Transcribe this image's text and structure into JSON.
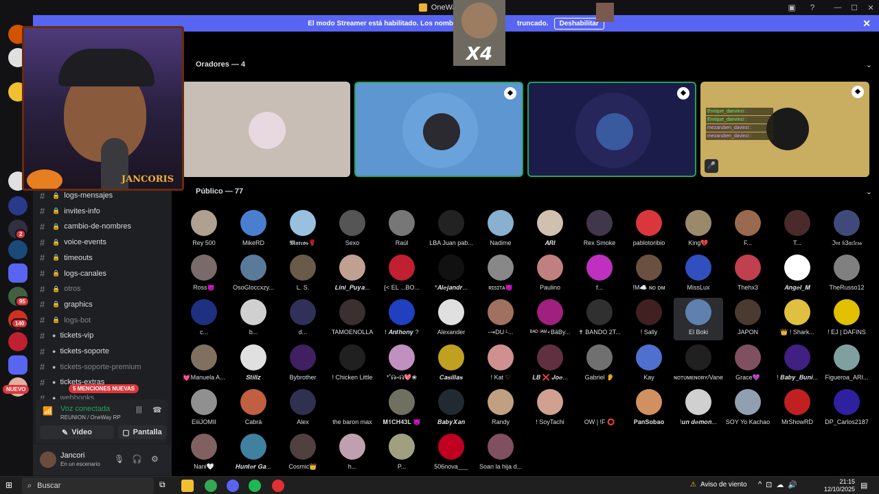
{
  "window": {
    "title": "OneWay"
  },
  "banner": {
    "message": "El modo Streamer está habilitado. Los nombres",
    "message_tail": "truncado.",
    "button": "Deshabilitar"
  },
  "overlay": {
    "webcam_label": "JANCORIS",
    "emote_text": "X4"
  },
  "guild_badges": {
    "b1": "2",
    "b2": "95",
    "b3": "140"
  },
  "nuevo_label": "NUEVO",
  "channels": [
    {
      "label": "logs-mensajes",
      "icon": "lock",
      "dim": false
    },
    {
      "label": "invites-info",
      "icon": "lock",
      "dim": false
    },
    {
      "label": "cambio-de-nombres",
      "icon": "lock",
      "dim": false
    },
    {
      "label": "voice-events",
      "icon": "lock",
      "dim": false
    },
    {
      "label": "timeouts",
      "icon": "lock",
      "dim": false
    },
    {
      "label": "logs-canales",
      "icon": "lock",
      "dim": false
    },
    {
      "label": "otros",
      "icon": "lock",
      "dim": true
    },
    {
      "label": "graphics",
      "icon": "lock",
      "dim": false
    },
    {
      "label": "logs-bot",
      "icon": "lock",
      "dim": true
    },
    {
      "label": "tickets-vip",
      "icon": "circle",
      "dim": false
    },
    {
      "label": "tickets-soporte",
      "icon": "circle",
      "dim": false
    },
    {
      "label": "tickets-soporte-premium",
      "icon": "circle",
      "dim": true
    },
    {
      "label": "tickets-extras",
      "icon": "circle",
      "dim": false
    },
    {
      "label": "webhooks",
      "icon": "circle",
      "dim": true
    }
  ],
  "mentions_badge": "5 MENCIONES NUEVAS",
  "voice": {
    "status": "Voz conectada",
    "channel": "REUNION / OneWay RP",
    "video_label": "Video",
    "screen_label": "Pantalla"
  },
  "user": {
    "name": "Jancori",
    "status": "En un escenario"
  },
  "stage": {
    "speakers_heading": "Oradores — 4",
    "audience_heading": "Público — 77",
    "tile_chat": [
      {
        "user": "Enrique_danvinci :",
        "text": ""
      },
      {
        "user": "Enrique_danvinci :",
        "text": ""
      },
      {
        "user": "mezaruben_davinci :",
        "text": ""
      },
      {
        "user": "mezaruben_davinci :",
        "text": ""
      }
    ]
  },
  "audience": [
    {
      "name": "Rey 500",
      "color": "#b0a090"
    },
    {
      "name": "MikeRD",
      "color": "#4a7fd0"
    },
    {
      "name": "𝕸𝖆𝖗𝖈𝖔𝖘🌹",
      "color": "#9ac0e0"
    },
    {
      "name": "Sexo",
      "color": "#555"
    },
    {
      "name": "Raúl",
      "color": "#777"
    },
    {
      "name": "LBA Juan pab...",
      "color": "#222"
    },
    {
      "name": "Nadime",
      "color": "#8ab0d0"
    },
    {
      "name": "𝑨𝑹𝑰",
      "color": "#d0c0b0"
    },
    {
      "name": "Rex Smoke",
      "color": "#40384a"
    },
    {
      "name": "pablotoribio",
      "color": "#da373c"
    },
    {
      "name": "King💔",
      "color": "#9a8a6a"
    },
    {
      "name": "F...",
      "color": "#9a6a50"
    },
    {
      "name": "T...",
      "color": "#4a2a2a"
    },
    {
      "name": "ℑ𝔪 𝔨3𝔞𝔯𝔩𝔢𝔰𝔰",
      "color": "#404a7a"
    },
    {
      "name": "Ross😈",
      "color": "#7a6a6a"
    },
    {
      "name": "OsoGloccxzy...",
      "color": "#5a7a9a"
    },
    {
      "name": "L. S.",
      "color": "#6a5a4a"
    },
    {
      "name": "𝑳𝒊𝒏𝒊_𝑷𝒖𝒚𝒂...",
      "color": "#c0a090"
    },
    {
      "name": "{< EL ...BO...",
      "color": "#c02030"
    },
    {
      "name": "*𝑨𝒍𝒆𝒋𝒂𝒏𝒅𝒓...",
      "color": "#111"
    },
    {
      "name": "ʀɪsɪᴛᴀ😈",
      "color": "#888"
    },
    {
      "name": "Paulino",
      "color": "#c08080"
    },
    {
      "name": "f...",
      "color": "#c030c0"
    },
    {
      "name": "!M☁️ ɴᴏ ᴅᴍ",
      "color": "#6a5040"
    },
    {
      "name": "MissLux",
      "color": "#3050c0"
    },
    {
      "name": "Thehx3",
      "color": "#c04050"
    },
    {
      "name": "𝑨𝒏𝒈𝒆𝒍_𝑴",
      "color": "#ffffff"
    },
    {
      "name": "TheRusso12",
      "color": "#808080"
    },
    {
      "name": "c...",
      "color": "#203080"
    },
    {
      "name": "b...",
      "color": "#d0d0d0"
    },
    {
      "name": "d...",
      "color": "#30305a"
    },
    {
      "name": "TAMOENOLLA",
      "color": "#3a3030"
    },
    {
      "name": "! 𝑨𝒏𝒕𝒉𝒐𝒏𝒚 ?",
      "color": "#2040c0"
    },
    {
      "name": "Alexander",
      "color": "#e0e0e0"
    },
    {
      "name": "-⇝DU ᴸ...",
      "color": "#a07060"
    },
    {
      "name": "ᴮᴬᴰ ᴵᴬᴹ⋆BäBy...",
      "color": "#a02080"
    },
    {
      "name": "✝ BANDO 2T...",
      "color": "#303030"
    },
    {
      "name": "! Sally",
      "color": "#402020"
    },
    {
      "name": "El Boki",
      "color": "#6080b0"
    },
    {
      "name": "JAPON",
      "color": "#4a3a30"
    },
    {
      "name": "👑 ! Shark...",
      "color": "#e0c040"
    },
    {
      "name": "! EJ | DAFINS",
      "color": "#e0c000"
    },
    {
      "name": "💓Manuela A...",
      "color": "#807060"
    },
    {
      "name": "𝑺𝒕𝒊𝒍𝒍𝒛",
      "color": "#e0e0e0"
    },
    {
      "name": "Bybrother",
      "color": "#402060"
    },
    {
      "name": "! Chicken Little",
      "color": "#202020"
    },
    {
      "name": "*˚ᕱ⑅ᕱ💖❀",
      "color": "#c090c0"
    },
    {
      "name": "𝑪𝒂𝒔𝒊𝒍𝒍𝒂𝒔",
      "color": "#c0a020"
    },
    {
      "name": "! Kat ♡",
      "color": "#d09090"
    },
    {
      "name": "𝑳𝑩 ❌ 𝑱𝒐𝒆...",
      "color": "#603040"
    },
    {
      "name": "Gabriel 👂",
      "color": "#707070"
    },
    {
      "name": "Kay",
      "color": "#5070d0"
    },
    {
      "name": "ɴᴏᴛᴜᴍᴇɴᴏʀʏ/Vane",
      "color": "#202020"
    },
    {
      "name": "Grace💜",
      "color": "#805060"
    },
    {
      "name": "! 𝑩𝒂𝒃𝒚_𝑩𝒖𝒏𝒊...",
      "color": "#402080"
    },
    {
      "name": "Figueroa_ARI...",
      "color": "#80a0a0"
    },
    {
      "name": "EiiiJOMII",
      "color": "#909090"
    },
    {
      "name": "Cabrá",
      "color": "#c06040"
    },
    {
      "name": "Alex",
      "color": "#303050"
    },
    {
      "name": "the baron max",
      "color": "#000000"
    },
    {
      "name": "𝐌𝟏𝐂𝐇𝟒𝟑𝐋 😈",
      "color": "#707060"
    },
    {
      "name": "𝑩𝒂𝒃𝒚𝑿𝒂𝒏",
      "color": "#202a30"
    },
    {
      "name": "Randy",
      "color": "#c0a080"
    },
    {
      "name": "! SoyTachi",
      "color": "#d0a090"
    },
    {
      "name": "OW | !F ⭕",
      "color": "#000000"
    },
    {
      "name": "𝐏𝐚𝐧𝐒𝐨𝐛𝐚𝐨",
      "color": "#d09060"
    },
    {
      "name": "!𝒖𝒏 𝒅𝒆𝒎𝒐𝒏...",
      "color": "#d0d0d0"
    },
    {
      "name": "SOY Yo Kachao",
      "color": "#90a0b0"
    },
    {
      "name": "MrShowRD",
      "color": "#c02020"
    },
    {
      "name": "DP_Carlos2187",
      "color": "#3020a0"
    },
    {
      "name": "Nani🤍",
      "color": "#806060"
    },
    {
      "name": "𝑯𝒖𝒏𝒕𝒆𝒓 𝑮𝒂...",
      "color": "#4080a0"
    },
    {
      "name": "Cosmic👑",
      "color": "#504040"
    },
    {
      "name": "h...",
      "color": "#c0a0b0"
    },
    {
      "name": "P...",
      "color": "#a0a080"
    },
    {
      "name": "506nova___",
      "color": "#c00020"
    },
    {
      "name": "Soan la hija d...",
      "color": "#805060"
    }
  ],
  "taskbar": {
    "search_placeholder": "Buscar",
    "weather": "Aviso de viento",
    "time": "21:15",
    "date": "12/10/2025"
  }
}
